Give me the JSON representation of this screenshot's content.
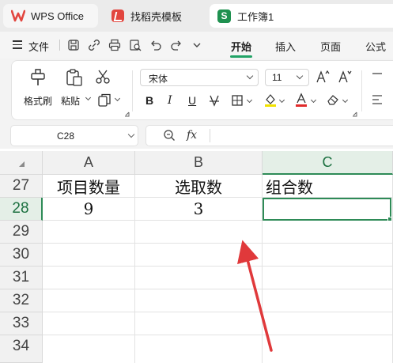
{
  "tabs": [
    {
      "label": "WPS Office",
      "icon": "wps-logo-icon"
    },
    {
      "label": "找稻壳模板",
      "icon": "daoke-template-icon"
    },
    {
      "label": "工作簿1",
      "icon": "spreadsheet-s-icon"
    }
  ],
  "menu": {
    "file": "文件",
    "items": [
      "开始",
      "插入",
      "页面",
      "公式"
    ],
    "active": "开始"
  },
  "ribbon": {
    "format_painter": "格式刷",
    "paste": "粘贴",
    "font_name": "宋体",
    "font_size": "11"
  },
  "formula_bar": {
    "cell_ref": "C28",
    "fx": "fx",
    "value": ""
  },
  "sheet": {
    "columns": [
      "A",
      "B",
      "C"
    ],
    "selected_column": "C",
    "rows": [
      "27",
      "28",
      "29",
      "30",
      "31",
      "32",
      "33",
      "34"
    ],
    "selected_row": "28",
    "cells": {
      "A27": "项目数量",
      "B27": "选取数",
      "C27": "组合数",
      "A28": "9",
      "B28": "3",
      "C28": ""
    }
  },
  "colors": {
    "accent_green": "#2e8b57",
    "wps_red": "#e2463f",
    "annotation_arrow": "#e0393b"
  }
}
